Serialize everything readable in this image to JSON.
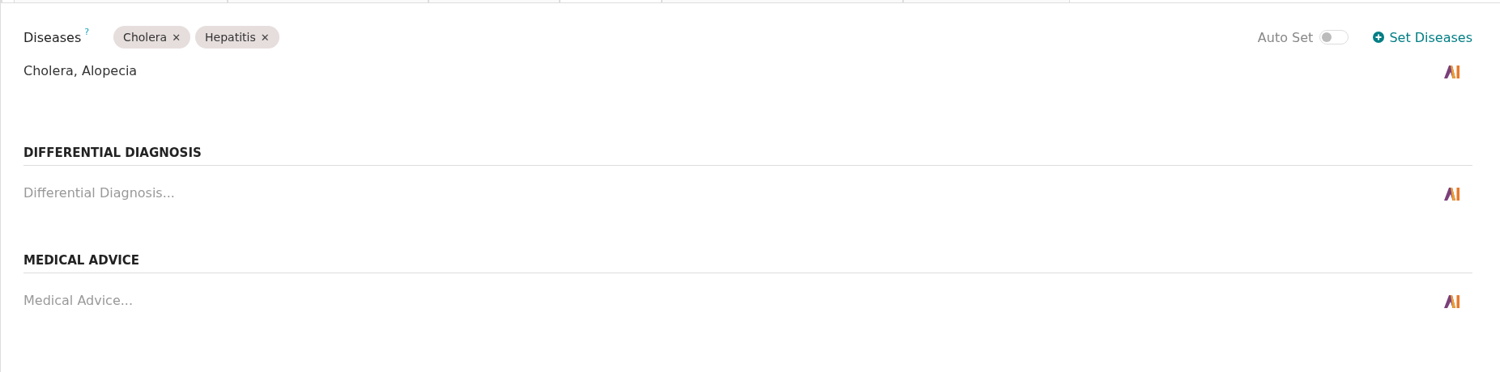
{
  "diseases": {
    "label": "Diseases",
    "help": "?",
    "tags": [
      {
        "label": "Cholera",
        "remove": "✕"
      },
      {
        "label": "Hepatitis",
        "remove": "✕"
      }
    ],
    "auto_set": {
      "label": "Auto Set",
      "on": false
    },
    "set_button": {
      "label": "Set Diseases"
    },
    "value": "Cholera, Alopecia"
  },
  "sections": [
    {
      "title": "DIFFERENTIAL DIAGNOSIS",
      "placeholder": "Differential Diagnosis..."
    },
    {
      "title": "MEDICAL ADVICE",
      "placeholder": "Medical Advice..."
    }
  ]
}
